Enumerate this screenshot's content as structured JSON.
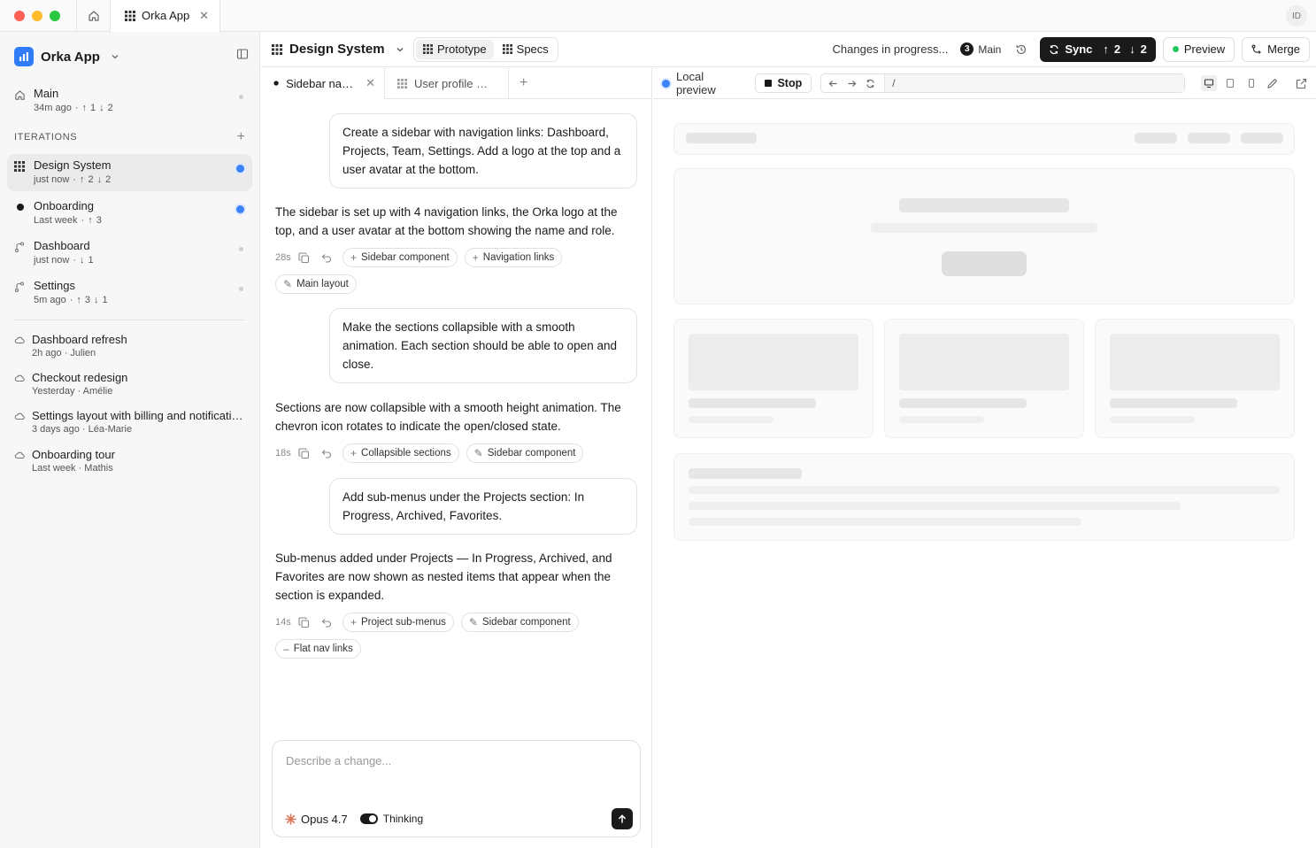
{
  "window": {
    "app_tab_label": "Orka App",
    "user_initials": "ID"
  },
  "sidebar": {
    "workspace_name": "Orka App",
    "main": {
      "label": "Main",
      "time": "34m ago",
      "up": "1",
      "down": "2"
    },
    "iterations_label": "ITERATIONS",
    "iterations": [
      {
        "label": "Design System",
        "time": "just now",
        "up": "2",
        "down": "2"
      },
      {
        "label": "Onboarding",
        "time": "Last week",
        "up": "3"
      },
      {
        "label": "Dashboard",
        "time": "just now",
        "down": "1"
      },
      {
        "label": "Settings",
        "time": "5m ago",
        "up": "3",
        "down": "1"
      }
    ],
    "history": [
      {
        "label": "Dashboard refresh",
        "meta": "2h ago · Julien"
      },
      {
        "label": "Checkout redesign",
        "meta": "Yesterday · Amélie"
      },
      {
        "label": "Settings layout with billing and notifications",
        "meta": "3 days ago · Léa-Marie"
      },
      {
        "label": "Onboarding tour",
        "meta": "Last week · Mathis"
      }
    ]
  },
  "topbar": {
    "project_name": "Design System",
    "segments": {
      "prototype": "Prototype",
      "specs": "Specs"
    },
    "status": "Changes in progress...",
    "branch_count": "3",
    "branch_name": "Main",
    "sync_label": "Sync",
    "sync_up": "2",
    "sync_down": "2",
    "preview_label": "Preview",
    "merge_label": "Merge"
  },
  "chat": {
    "tabs": [
      {
        "label": "Sidebar navigation"
      },
      {
        "label": "User profile settings"
      }
    ],
    "messages": [
      {
        "prompt": "Create a sidebar with navigation links: Dashboard, Projects, Team, Settings. Add a logo at the top and a user avatar at the bottom.",
        "reply": "The sidebar is set up with 4 navigation links, the Orka logo at the top, and a user avatar at the bottom showing the name and role.",
        "time": "28s",
        "chips": [
          "Sidebar component",
          "Navigation links",
          "Main layout"
        ]
      },
      {
        "prompt": "Make the sections collapsible with a smooth animation. Each section should be able to open and close.",
        "reply": "Sections are now collapsible with a smooth height animation. The chevron icon rotates to indicate the open/closed state.",
        "time": "18s",
        "chips": [
          "Collapsible sections",
          "Sidebar component"
        ]
      },
      {
        "prompt": "Add sub-menus under the Projects section: In Progress, Archived, Favorites.",
        "reply": "Sub-menus added under Projects — In Progress, Archived, and Favorites are now shown as nested items that appear when the section is expanded.",
        "time": "14s",
        "chips": [
          "Project sub-menus",
          "Sidebar component",
          "Flat nav links"
        ]
      }
    ],
    "composer_placeholder": "Describe a change...",
    "model_label": "Opus 4.7",
    "thinking_label": "Thinking"
  },
  "preview": {
    "local_label": "Local preview",
    "stop_label": "Stop",
    "url_path": "/"
  },
  "colors": {
    "accent_blue": "#3b82f6",
    "sync_bg": "#1a1a1a",
    "preview_green": "#22c55e",
    "app_logo": "#2f7cf6"
  }
}
